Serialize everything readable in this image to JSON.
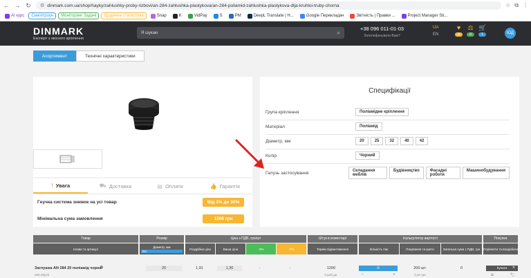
{
  "browser": {
    "url": "dinmark.com.ua/shop/hayky/zahlushky-proby-rizbovi/an-284-zahlushka-plastykova/an-284-poliamid-zahlushka-plastykova-dlja-kruhloi-truby-chorna",
    "bookmarks": [
      {
        "label": "AI курс",
        "color": "#7b3fe4",
        "tag": false
      },
      {
        "label": "Сингетроун",
        "color": "#3b9cdb",
        "tag": true
      },
      {
        "label": "Моніторинг Задачі",
        "color": "#4caf50",
        "tag": true
      },
      {
        "label": "Щоденна статистика",
        "color": "#f7b733",
        "tag": true
      },
      {
        "label": "Snap",
        "color": "#b069d6",
        "tag": false
      },
      {
        "label": "K",
        "color": "#222222",
        "tag": false
      },
      {
        "label": "VidPay",
        "color": "#3aa14a",
        "tag": false
      },
      {
        "label": "S",
        "color": "#1e88e5",
        "tag": false
      },
      {
        "label": "PM",
        "color": "#2b6cb0",
        "tag": false
      },
      {
        "label": "DeepL Translate | H...",
        "color": "#0f2b46",
        "tag": false
      },
      {
        "label": "Google Перекладач",
        "color": "#4285f4",
        "tag": false
      },
      {
        "label": "Звітність | Правки ...",
        "color": "#e74c3c",
        "tag": false
      },
      {
        "label": "Project Manager Sti...",
        "color": "#7b3fe4",
        "tag": false
      }
    ]
  },
  "header": {
    "logo": "DINMARK",
    "tagline": "Експерт з якісного кріплення",
    "search_placeholder": "Я шукаю",
    "phone": "+38 096 011-01-03",
    "phone_sub": "Зателефонувати Вам?",
    "lang_active": "UA",
    "lang_other": "EN",
    "icons": [
      {
        "name": "heart-icon",
        "glyph": "♥",
        "count": "2",
        "color": "#f7b733"
      },
      {
        "name": "scales-icon",
        "glyph": "⚖",
        "count": "0",
        "color": "#4caf50"
      },
      {
        "name": "cart-icon",
        "glyph": "🛒",
        "count": "1",
        "color": "#3b9cdb"
      }
    ],
    "avatar": "ЮД"
  },
  "tabs": [
    {
      "label": "Асортимент",
      "active": true
    },
    {
      "label": "Технічні характеристики",
      "active": false
    }
  ],
  "info": {
    "tabs": [
      {
        "label": "Увага",
        "icon": "!",
        "active": true
      },
      {
        "label": "Доставка",
        "icon": "⛟",
        "active": false
      },
      {
        "label": "Оплати",
        "icon": "▤",
        "active": false
      },
      {
        "label": "Гарантія",
        "icon": "👍",
        "active": false
      }
    ],
    "rows": [
      {
        "label": "Гнучка система знижок на усі товар",
        "value": "Від 3% до 30%"
      },
      {
        "label": "Мінімальна сума замовлення",
        "value": "1200 грн"
      }
    ]
  },
  "spec": {
    "title": "Специфікації",
    "rows": [
      {
        "label": "Група кріплення",
        "values": [
          "Поліамідне кріплення"
        ]
      },
      {
        "label": "Матеріал",
        "values": [
          "Поліамід"
        ]
      },
      {
        "label": "Діаметр, мм",
        "values": [
          "20",
          "25",
          "32",
          "40",
          "42"
        ]
      },
      {
        "label": "Колір",
        "values": [
          "Чорний"
        ]
      },
      {
        "label": "Галузь застосування",
        "values": [
          "Складання меблів",
          "Будівництво",
          "Фасадні роботи",
          "Машинобудування"
        ]
      }
    ]
  },
  "table": {
    "groups": [
      {
        "title": "Товар",
        "subs": [
          "Назва та артикул"
        ]
      },
      {
        "title": "Розмір",
        "subs": [
          "Діаметр, мм"
        ]
      },
      {
        "title": "Ціна з ПДВ, грн/шт",
        "subs": [
          "Роздрібна ціна",
          "Ваша ціна",
          "-3%",
          "-7%"
        ]
      },
      {
        "title": "Штук в коментарі",
        "subs": [
          "Термін відвантаження"
        ]
      },
      {
        "title": "Калькулятор вартості",
        "subs": [
          "Кількість пак",
          "Пакування та кратн",
          "Загальна сума з ПДВ, грн"
        ]
      },
      {
        "title": "Покупка",
        "subs": [
          "Порівняти та вподобати"
        ]
      }
    ],
    "size_filter": "Всі",
    "row": {
      "name": "Заглушка AN 284 20 поліамід чорна",
      "sku": "284-20pch",
      "size": "20",
      "retail": "1,91",
      "your_price": "1,30",
      "d3": "-",
      "d7": "-",
      "stock": "1200",
      "term": "0 роб.дн.",
      "qty": "0",
      "pack": "200 шт.",
      "pack_price": "0,42 грн",
      "total": "0",
      "buy": "Купити"
    }
  }
}
